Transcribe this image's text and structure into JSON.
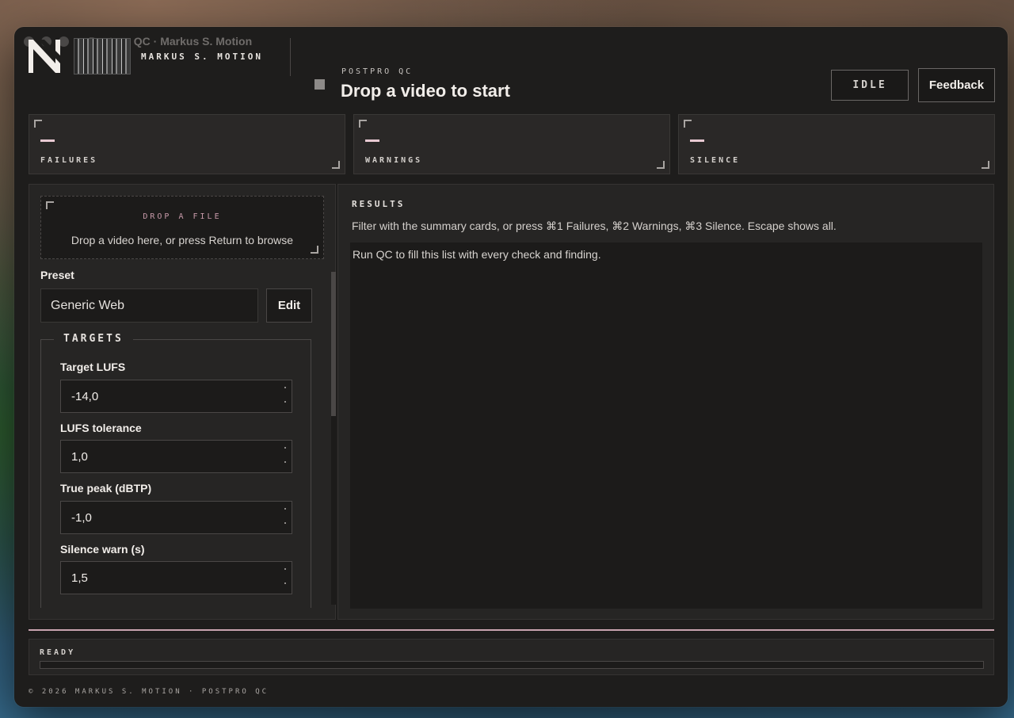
{
  "window": {
    "title": "Postpro QC · Markus S. Motion"
  },
  "header": {
    "brand": "MARKUS S. MOTION",
    "app_label": "POSTPRO QC",
    "app_title": "Drop a video to start",
    "status_badge": "IDLE",
    "feedback_label": "Feedback"
  },
  "summary": {
    "cards": [
      {
        "label": "FAILURES"
      },
      {
        "label": "WARNINGS"
      },
      {
        "label": "SILENCE"
      }
    ]
  },
  "dropzone": {
    "label": "DROP A FILE",
    "text": "Drop a video here, or press Return to browse"
  },
  "preset": {
    "label": "Preset",
    "selected": "Generic Web",
    "edit_label": "Edit"
  },
  "targets": {
    "legend": "TARGETS",
    "fields": [
      {
        "label": "Target LUFS",
        "value": "-14,0"
      },
      {
        "label": "LUFS tolerance",
        "value": "1,0"
      },
      {
        "label": "True peak (dBTP)",
        "value": "-1,0"
      },
      {
        "label": "Silence warn (s)",
        "value": "1,5"
      }
    ]
  },
  "results": {
    "title": "RESULTS",
    "hint": "Filter with the summary cards, or press ⌘1 Failures, ⌘2 Warnings, ⌘3 Silence. Escape shows all.",
    "empty_text": "Run QC to fill this list with every check and finding."
  },
  "status": {
    "label": "READY",
    "progress": 0
  },
  "footer": {
    "copyright": "© 2026 MARKUS S. MOTION · POSTPRO QC"
  },
  "colors": {
    "accent": "#e8c9d2",
    "rule": "#c9a4b0",
    "panel": "#262524",
    "window": "#1e1d1c"
  }
}
